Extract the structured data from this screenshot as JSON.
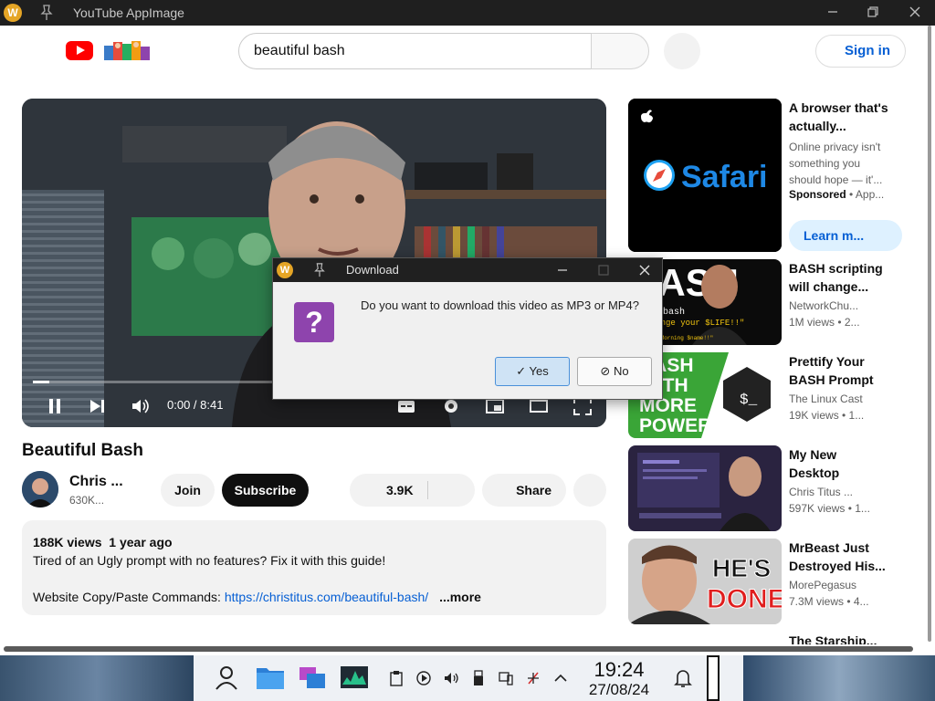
{
  "window": {
    "title": "YouTube AppImage",
    "logo_letter": "W"
  },
  "header": {
    "search_value": "beautiful bash",
    "signin_label": "Sign in"
  },
  "player": {
    "time": "0:00 / 8:41",
    "progress": 0.03
  },
  "video": {
    "title": "Beautiful Bash",
    "channel": "Chris ...",
    "subscribers": "630K...",
    "join_label": "Join",
    "subscribe_label": "Subscribe",
    "likes": "3.9K",
    "share_label": "Share",
    "views": "188K views",
    "age": "1 year ago",
    "description": "Tired of an Ugly prompt with no features? Fix it with this guide!",
    "website_label": "Website Copy/Paste Commands:",
    "website_link": "https://christitus.com/beautiful-bash/",
    "more_label": "...more"
  },
  "ad": {
    "title": "A browser that's actually...",
    "description": "Online privacy isn't something you should hope — it'...",
    "sponsored": "Sponsored",
    "advertiser": "App...",
    "brand": "Safari",
    "learn_label": "Learn m..."
  },
  "recommendations": [
    {
      "title": "BASH scripting will change...",
      "channel": "NetworkChu...",
      "meta": "1M views • 2..."
    },
    {
      "title": "Prettify Your BASH Prompt",
      "channel": "The Linux Cast",
      "meta": "19K views • 1..."
    },
    {
      "title": "My New Desktop",
      "channel": "Chris Titus ...",
      "meta": "597K views • 1..."
    },
    {
      "title": "MrBeast Just Destroyed His...",
      "channel": "MorePegasus",
      "meta": "7.3M views • 4..."
    },
    {
      "title": "The Starship..."
    }
  ],
  "thumb_text": {
    "bash1": "BASH",
    "bash1_code1": "/bin/bash",
    "bash1_code2": "\"Change your $LIFE!!\"",
    "bash1_code3": "\"Good Morning $name!!\"",
    "bash2_line1": "BASH",
    "bash2_line2": "WITH",
    "bash2_line3": "MORE",
    "bash2_line4": "POWER!",
    "bash2_term": "$_",
    "mrbeast_line1": "HE'S",
    "mrbeast_line2": "DONE"
  },
  "dialog": {
    "title": "Download",
    "logo_letter": "W",
    "icon_glyph": "?",
    "message": "Do you want to download this video as MP3 or MP4?",
    "yes_label": "Yes",
    "no_label": "No"
  },
  "taskbar": {
    "time": "19:24",
    "date": "27/08/24"
  },
  "colors": {
    "youtube_red": "#ff0000",
    "link_blue": "#065fd4",
    "dialog_icon": "#8e44ad",
    "titlebar": "#1f1f1f"
  }
}
